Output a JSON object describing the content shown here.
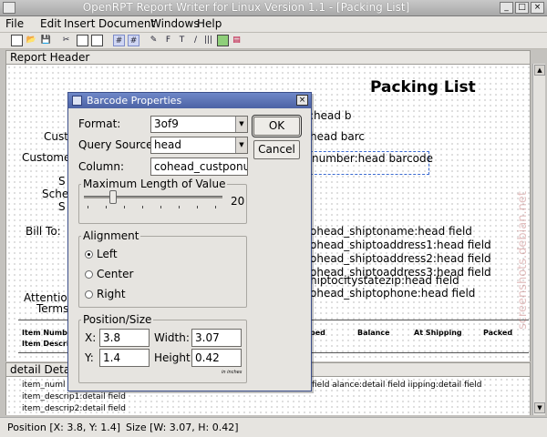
{
  "window": {
    "title": "OpenRPT Report Writer for Linux Version 1.1 - [Packing List]",
    "minimize_glyph": "_",
    "maximize_glyph": "□",
    "close_glyph": "×"
  },
  "menu": {
    "file": "File",
    "edit": "Edit",
    "insert": "Insert",
    "document": "Document",
    "windows": "Windows",
    "help": "Help"
  },
  "toolbar_icons": [
    "new-icon",
    "open-icon",
    "save-icon",
    "cut-icon",
    "copy-icon",
    "paste-icon",
    "grid-icon",
    "snap-grid-icon",
    "select-icon",
    "field-icon",
    "text-icon",
    "line-icon",
    "barcode-icon",
    "rectangle-icon",
    "graph-icon"
  ],
  "toolbar_glyphs": {
    "field": "F",
    "text": "T",
    "barcode": "|||",
    "grid": "#"
  },
  "sections": {
    "report_header": "Report Header",
    "detail": "detail Detail"
  },
  "report": {
    "title": "Packing List",
    "labels": {
      "cust_partial": "Cust",
      "custome_partial": "Custome",
      "s_partial": "S",
      "sche_partial": "Sche",
      "s2_partial": "S",
      "bill_to": "Bill To:",
      "attention": "Attention",
      "terms": "Terms"
    },
    "fields": {
      "f1": ":head b",
      "f2": "head barc",
      "f3": "number:head barcode",
      "f4": "ohead_shiptoname:head field",
      "f5": "ohead_shiptoaddress1:head field",
      "f6": "ohead_shiptoaddress2:head field",
      "f7": "ohead_shiptoaddress3:head field",
      "f8": "hiptocitystatezip:head field",
      "f9": "ohead_shiptophone:head field"
    },
    "columns": {
      "item_number": "Item Numbe",
      "item_description": "Item Descripti",
      "ped": "ped",
      "balance": "Balance",
      "at_shipping": "At Shipping",
      "packed": "Packed"
    },
    "detail_rows": {
      "r1": "item_numl",
      "r1_right": "field  alance:detail field  iipping:detail field",
      "r2": "item_descrip1:detail field",
      "r3": "item_descrip2:detail field"
    }
  },
  "dialog": {
    "title": "Barcode Properties",
    "format_label": "Format:",
    "format_value": "3of9",
    "query_label": "Query Source:",
    "query_value": "head",
    "column_label": "Column:",
    "column_value": "cohead_custponumb",
    "ok": "OK",
    "cancel": "Cancel",
    "max_length_label": "Maximum Length of Value",
    "max_length_value": "20",
    "max_length_level": 0.21,
    "alignment_label": "Alignment",
    "align_left": "Left",
    "align_center": "Center",
    "align_right": "Right",
    "alignment_selected": "Left",
    "possize_label": "Position/Size",
    "x_label": "X:",
    "x_value": "3.8",
    "y_label": "Y:",
    "y_value": "1.4",
    "width_label": "Width:",
    "width_value": "3.07",
    "height_label": "Height:",
    "height_value": "0.42",
    "units": "in inches"
  },
  "status": {
    "position": "Position [X: 3.8, Y: 1.4]",
    "size": "Size [W: 3.07, H: 0.42]"
  },
  "watermark": "screenshots.debian.net"
}
